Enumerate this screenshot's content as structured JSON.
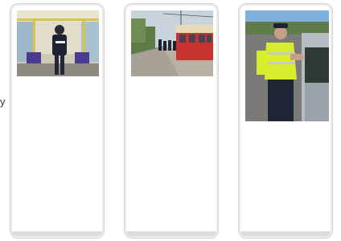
{
  "edge_text": "y",
  "cards": [
    {
      "photo": "police-officer-on-tram"
    },
    {
      "photo": "tram-stop-platform-officers"
    },
    {
      "photo": "officer-checking-driver"
    }
  ]
}
